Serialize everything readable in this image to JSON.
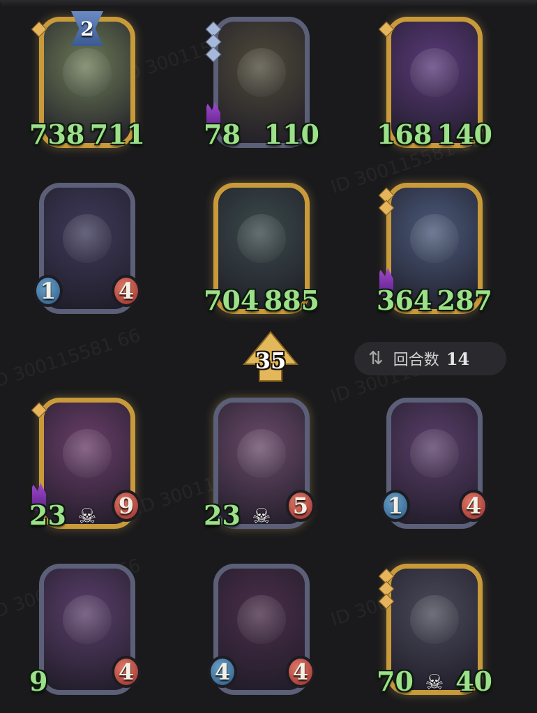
{
  "round": {
    "label": "回合数",
    "value": "14",
    "icon": "swap-arrows-icon"
  },
  "timer": {
    "value": "35",
    "icon": "up-arrow-timer-icon"
  },
  "watermark": "ID 300115581 66",
  "enemy_row1": [
    {
      "name": "unicorn-knight",
      "frame": "gold",
      "tier": "2",
      "atk": "738",
      "hp": "711",
      "atk_style": "plain",
      "gems": [
        "gold"
      ],
      "art": "#6b7a56"
    },
    {
      "name": "mushroom-goblin",
      "frame": "slate",
      "atk": "78",
      "hp": "110",
      "atk_style": "plain",
      "horn": true,
      "gems": [
        "blue",
        "blue",
        "blue"
      ],
      "art": "#4e4a3a"
    },
    {
      "name": "star-sorceress",
      "frame": "gold",
      "atk": "168",
      "hp": "140",
      "atk_style": "plain",
      "gems": [
        "gold"
      ],
      "art": "#5a3a7a"
    }
  ],
  "enemy_row2": [
    {
      "name": "snake-sorceress",
      "frame": "slate",
      "atk": "1",
      "hp": "4",
      "atk_style": "orb",
      "art": "#3e3a5a"
    },
    {
      "name": "fang-plant",
      "frame": "gold",
      "atk": "704",
      "hp": "885",
      "atk_style": "plain",
      "art": "#3a4a4a"
    },
    {
      "name": "bearded-king",
      "frame": "gold",
      "atk": "364",
      "hp": "287",
      "atk_style": "plain",
      "horn": true,
      "gems": [
        "gold",
        "gold"
      ],
      "art": "#4a5a7a"
    }
  ],
  "player_row1": [
    {
      "name": "horned-ogre",
      "frame": "gold",
      "atk": "23",
      "hp": "9",
      "atk_style": "plain",
      "hp_style": "orb",
      "skull": true,
      "horn": true,
      "gems": [
        "gold"
      ],
      "art": "#6a3e6a"
    },
    {
      "name": "masked-wrestler",
      "frame": "slate-gold",
      "atk": "23",
      "hp": "5",
      "atk_style": "plain",
      "hp_style": "orb",
      "skull": true,
      "art": "#6a4a6a"
    },
    {
      "name": "rat-bandit",
      "frame": "slate",
      "atk": "1",
      "hp": "4",
      "atk_style": "orb",
      "art": "#5a3e6a"
    }
  ],
  "player_row2": [
    {
      "name": "rat-bandit",
      "frame": "slate",
      "atk": "9",
      "hp": "4",
      "atk_style": "plain",
      "hp_style": "orb",
      "art": "#5a3e6a"
    },
    {
      "name": "clown-jester",
      "frame": "slate",
      "atk": "4",
      "hp": "4",
      "atk_style": "orb",
      "art": "#4a2e4a"
    },
    {
      "name": "helmet-soldier",
      "frame": "gold",
      "atk": "70",
      "hp": "40",
      "atk_style": "plain",
      "skull": true,
      "gems": [
        "gold",
        "gold",
        "gold"
      ],
      "art": "#4a4a5a"
    }
  ],
  "colors": {
    "background": "#1a1a1c",
    "gold_frame": "#c99a3a",
    "slate_frame": "#5c5f78",
    "stat_green": "#9de08a",
    "atk_orb": "#2b5b86",
    "hp_orb": "#9a2e28"
  }
}
